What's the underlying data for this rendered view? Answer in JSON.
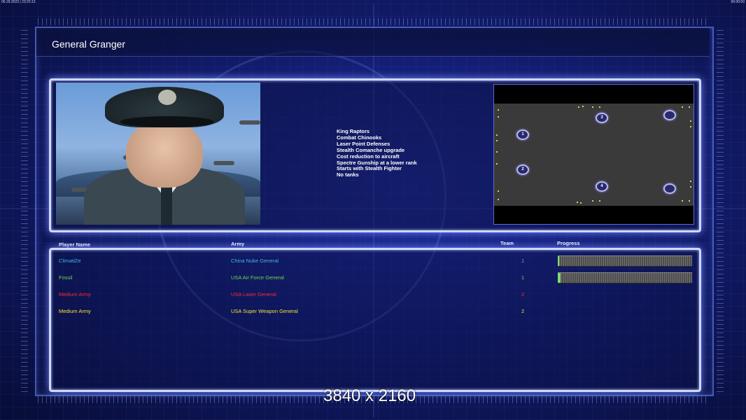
{
  "status": {
    "left": "06.29.2023 | 23:25:13",
    "right": "00:00:00"
  },
  "general": {
    "title": "General Granger",
    "features": [
      "King Raptors",
      "Combat Chinooks",
      "Laser Point Defenses",
      "Stealth Comanche upgrade",
      "Cost reduction to aircraft",
      "Spectre Gunship at a lower rank",
      "Starts with Stealth Fighter",
      "No tanks"
    ]
  },
  "map": {
    "spawns": [
      "1",
      "2",
      "3",
      "4",
      "",
      ""
    ]
  },
  "table": {
    "headers": {
      "player": "Player Name",
      "army": "Army",
      "team": "Team",
      "progress": "Progress"
    },
    "rows": [
      {
        "name": "ClimatiZe",
        "army": "China Nuke General",
        "team": "1",
        "color": "#3fb7e8",
        "progress": 0.01
      },
      {
        "name": "Fossil",
        "army": "USA Air Force General",
        "team": "1",
        "color": "#6ed84f",
        "progress": 0.02
      },
      {
        "name": "Medium Army",
        "army": "USA Laser General",
        "team": "2",
        "color": "#ff2a2a",
        "progress": null
      },
      {
        "name": "Medium Army",
        "army": "USA Super Weapon General",
        "team": "2",
        "color": "#f3e23a",
        "progress": null
      }
    ]
  },
  "overlay": {
    "resolution": "3840 x 2160"
  }
}
